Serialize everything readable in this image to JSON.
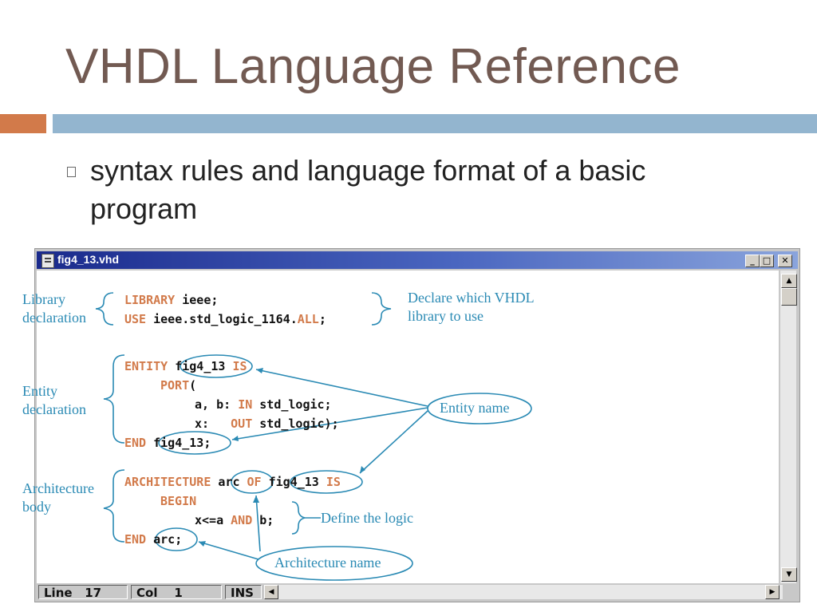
{
  "slide": {
    "title": "VHDL Language Reference",
    "bullet": "syntax rules and language format of a basic program"
  },
  "window": {
    "title": "fig4_13.vhd",
    "controls": {
      "minimize": "_",
      "maximize": "□",
      "close": "✕"
    }
  },
  "code": {
    "line1": {
      "kw": "LIBRARY",
      "rest": " ieee;"
    },
    "line2": {
      "kw": "USE",
      "rest1": " ieee.std_logic_1164.",
      "kw2": "ALL",
      "rest2": ";"
    },
    "line3": {
      "kw": "ENTITY",
      "name": "fig4_13",
      "kw2": "IS"
    },
    "line4": {
      "kw": "PORT",
      "rest": "("
    },
    "line5": {
      "pre": "a, b: ",
      "kw": "IN",
      "rest": " std_logic;"
    },
    "line6": {
      "pre": "x:   ",
      "kw": "OUT",
      "rest": " std_logic);"
    },
    "line7": {
      "kw": "END",
      "name": "fig4_13",
      "rest": ";"
    },
    "line8": {
      "kw": "ARCHITECTURE",
      "name": "arc",
      "kw2": "OF",
      "name2": "fig4_13",
      "kw3": "IS"
    },
    "line9": {
      "kw": "BEGIN"
    },
    "line10": {
      "pre": "x<=a ",
      "kw": "AND",
      "rest": " b;"
    },
    "line11": {
      "kw": "END",
      "name": "arc",
      "rest": ";"
    }
  },
  "annotations": {
    "library_declaration": "Library\ndeclaration",
    "declare_library": "Declare which VHDL\nlibrary to use",
    "entity_declaration": "Entity\ndeclaration",
    "entity_name": "Entity name",
    "architecture_body": "Architecture\nbody",
    "define_logic": "Define the logic",
    "architecture_name": "Architecture name"
  },
  "statusbar": {
    "line": "Line   17",
    "col": "Col    1",
    "ins": "INS"
  },
  "colors": {
    "keyword": "#d27a4a",
    "annotation": "#2a8ab4",
    "title": "#725a52"
  }
}
